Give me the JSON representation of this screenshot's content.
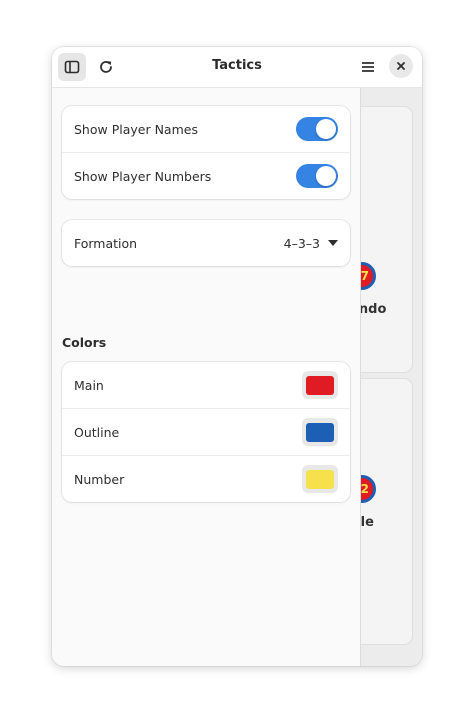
{
  "window": {
    "title": "Tactics"
  },
  "header": {
    "sidebar_icon": "sidebar-toggle-icon",
    "refresh_icon": "refresh-icon",
    "menu_icon": "hamburger-menu-icon",
    "close_icon": "close-icon"
  },
  "sidebar": {
    "show_player_names": {
      "label": "Show Player Names",
      "enabled": true
    },
    "show_player_numbers": {
      "label": "Show Player Numbers",
      "enabled": true
    },
    "formation": {
      "label": "Formation",
      "value": "4–3–3"
    },
    "colors_title": "Colors",
    "colors": [
      {
        "label": "Main",
        "color": "#e01b24"
      },
      {
        "label": "Outline",
        "color": "#1c5fb5"
      },
      {
        "label": "Number",
        "color": "#f6e04b"
      }
    ]
  },
  "content": {
    "players": [
      {
        "number": "7",
        "name": "ondo"
      },
      {
        "number": "2",
        "name": "tlle"
      }
    ]
  },
  "colors": {
    "accent": "#3584e4"
  }
}
